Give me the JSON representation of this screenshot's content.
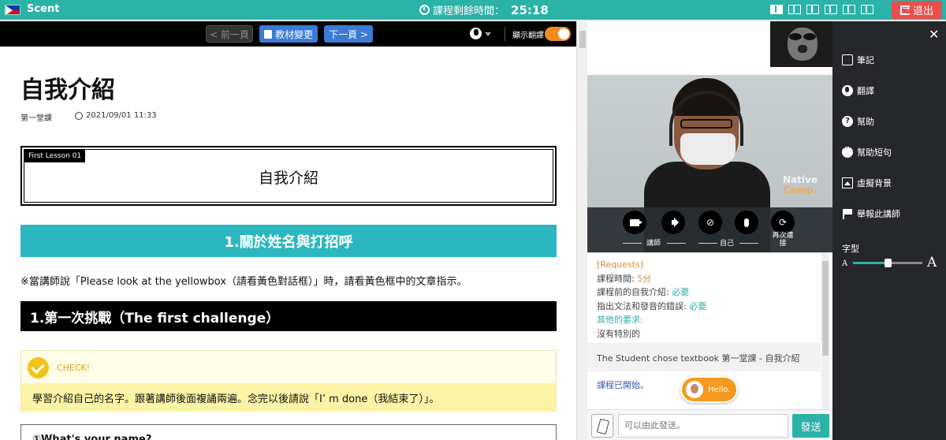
{
  "topbar": {
    "app_name": "Scent",
    "timer_label": "課程剩餘時間：",
    "timer_value": "25:18",
    "layout_icons": [
      "layout-1-icon",
      "layout-2-icon",
      "layout-3-icon",
      "layout-4-icon",
      "layout-5-icon",
      "layout-6-icon"
    ],
    "exit_label": "退出"
  },
  "toolbar": {
    "prev_label": "< 前一頁",
    "change_label": "教材變更",
    "next_label": "下一頁 >",
    "translate_label": "顯示翻譯",
    "translate_on": true
  },
  "doc": {
    "title": "自我介紹",
    "lesson_label": "第一堂課",
    "date": "2021/09/01 11:33",
    "lesson_tag": "First Lesson 01",
    "lesson_name": "自我介紹",
    "section_title": "1.關於姓名與打招呼",
    "note": "※當講師說「Please look at the yellowbox（請看黃色對話框）」時，請看黃色框中的文章指示。",
    "challenge_title": "1.第一次挑戰（The first challenge）",
    "check_label": "CHECK!",
    "check_text": "學習介紹自己的名字。跟著講師後面複誦兩遍。念完以後請說「I’ m done（我結束了）」。",
    "question": "①What's your name?"
  },
  "video": {
    "watermark_line1": "Native",
    "watermark_line2": "Camp.",
    "teacher_label": "講師",
    "self_label": "自己",
    "reconnect_label": "再次連接"
  },
  "chat": {
    "requests_header": "[Requests]",
    "req1_label": "課程時間: ",
    "req1_value": "5分",
    "req2_label": "課程前的自我介紹: ",
    "req2_value": "必要",
    "req3_label": "指出文法和發音的錯誤: ",
    "req3_value": "必要",
    "req4_label": "其他的要求:",
    "req4_value": "沒有特別的",
    "chose_text": "The Student chose textbook 第一堂課 - 自我介紹",
    "started_text": "課程已開始。",
    "hello_text": "Hello.",
    "input_placeholder": "可以由此發送。",
    "send_label": "發送"
  },
  "sidebar": {
    "items": [
      {
        "label": "筆記",
        "icon": "note-icon"
      },
      {
        "label": "翻譯",
        "icon": "globe-icon"
      },
      {
        "label": "幫助",
        "icon": "help-icon"
      },
      {
        "label": "幫助短句",
        "icon": "chat-bubble-icon"
      },
      {
        "label": "虛擬背景",
        "icon": "image-icon"
      },
      {
        "label": "舉報此講師",
        "icon": "flag-icon"
      }
    ],
    "font_label": "字型",
    "font_small": "A",
    "font_large": "A",
    "font_size_fraction": 0.5
  },
  "colors": {
    "teal": "#2bb2a9",
    "exit_red": "#e8504d",
    "blue_button": "#3a7bd5",
    "orange": "#f48a1e",
    "sidebar_bg": "#26272a"
  }
}
